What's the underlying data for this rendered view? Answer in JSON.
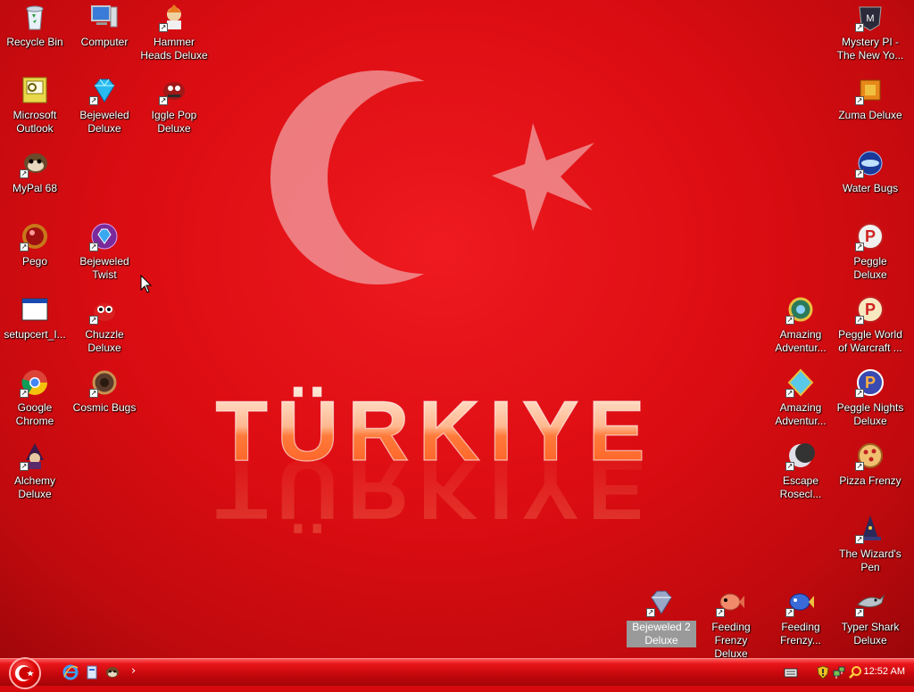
{
  "wallpaper": {
    "text": "TÜRKIYE",
    "colors": {
      "background": "#d40a0f",
      "emblem": "#f08f92",
      "text_fill": "#ffb38a"
    }
  },
  "desktop_icons": {
    "recycle_bin": "Recycle Bin",
    "computer": "Computer",
    "hammer_heads": "Hammer Heads Deluxe",
    "outlook": "Microsoft Outlook",
    "bejeweled_deluxe": "Bejeweled Deluxe",
    "iggle_pop": "Iggle Pop Deluxe",
    "mypal": "MyPal 68",
    "pego": "Pego",
    "bejeweled_twist": "Bejeweled Twist",
    "setupcert": "setupcert_I...",
    "chuzzle": "Chuzzle Deluxe",
    "chrome": "Google Chrome",
    "cosmic_bugs": "Cosmic Bugs",
    "alchemy": "Alchemy Deluxe",
    "mystery_pi": "Mystery PI - The New Yo...",
    "zuma": "Zuma Deluxe",
    "water_bugs": "Water Bugs",
    "peggle": "Peggle Deluxe",
    "amazing_adv_1": "Amazing Adventur...",
    "peggle_wow": "Peggle World of Warcraft ...",
    "amazing_adv_2": "Amazing Adventur...",
    "peggle_nights": "Peggle Nights Deluxe",
    "escape_rosecliff": "Escape Rosecl...",
    "pizza_frenzy": "Pizza Frenzy",
    "wizards_pen": "The Wizard's Pen",
    "bejeweled_2": "Bejeweled 2 Deluxe",
    "feeding_frenzy": "Feeding Frenzy Deluxe",
    "feeding_frenzy_2": "Feeding Frenzy...",
    "typer_shark": "Typer Shark Deluxe"
  },
  "taskbar": {
    "clock": "12:52 AM",
    "quick_launch_more": "›",
    "icons": [
      "start-orb-icon",
      "internet-explorer-icon",
      "file-icon",
      "mypal-icon",
      "keyboard-icon",
      "shield-icon",
      "network-icon",
      "search-icon"
    ]
  }
}
